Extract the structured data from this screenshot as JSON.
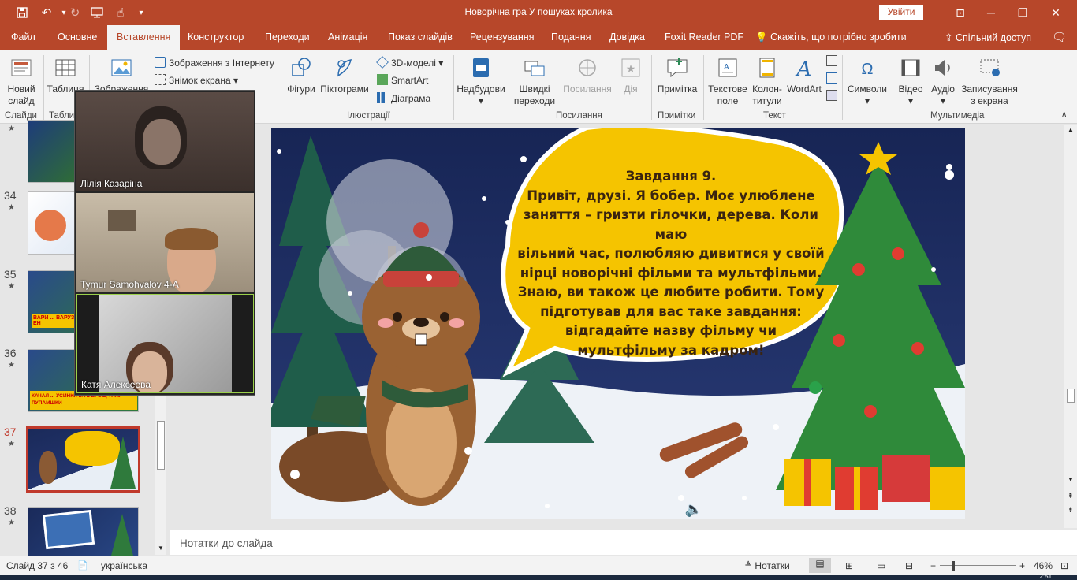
{
  "titlebar": {
    "document_title": "Новорічна гра У пошуках кролика",
    "sign_in": "Увійти",
    "ribbon_display_symbol": "⊡",
    "minimize_symbol": "─",
    "restore_symbol": "❐",
    "close_symbol": "✕"
  },
  "tabs": [
    {
      "label": "Файл"
    },
    {
      "label": "Основне"
    },
    {
      "label": "Вставлення"
    },
    {
      "label": "Конструктор"
    },
    {
      "label": "Переходи"
    },
    {
      "label": "Анімація"
    },
    {
      "label": "Показ слайдів"
    },
    {
      "label": "Рецензування"
    },
    {
      "label": "Подання"
    },
    {
      "label": "Довідка"
    },
    {
      "label": "Foxit Reader PDF"
    }
  ],
  "tell_me": "Скажіть, що потрібно зробити",
  "share": "Спільний доступ",
  "ribbon": {
    "new_slide": "Новий слайд",
    "table": "Таблиця",
    "images": "Зображення",
    "online_images": "Зображення з Інтернету",
    "screenshot": "Знімок екрана",
    "shapes": "Фігури",
    "icons": "Піктограми",
    "models_3d": "3D-моделі",
    "smartart": "SmartArt",
    "chart": "Діаграма",
    "addins": "Надбудови",
    "quick_links": "Швидкі переходи",
    "links": "Посилання",
    "action": "Дія",
    "comment": "Примітка",
    "text_box": "Текстове поле",
    "header_footer": "Колон-титули",
    "wordart": "WordArt",
    "symbols": "Символи",
    "video": "Відео",
    "audio": "Аудіо",
    "screen_recording": "Записування з екрана",
    "groups": {
      "slides": "Слайди",
      "tables": "Табли",
      "illustrations": "Ілюстрації",
      "links": "Посилання",
      "comments": "Примітки",
      "text": "Текст",
      "multimedia": "Мультимедіа"
    }
  },
  "thumbnails": [
    {
      "number": "34",
      "star": "★"
    },
    {
      "number": "35",
      "star": "★",
      "caption": "ВАРИ ... ВАРУЗ ЕН"
    },
    {
      "number": "36",
      "star": "★",
      "caption": "КАЧАЛ ... УСИНКИ ... ЛУБГОЩ ТЯКУ ПУПАМШКИ"
    },
    {
      "number": "37",
      "star": "★"
    },
    {
      "number": "38",
      "star": "★"
    }
  ],
  "video_participants": [
    {
      "name": "Лілія Казаріна"
    },
    {
      "name": "Tymur Samohvalov 4-A"
    },
    {
      "name": "Катя Алексеева"
    }
  ],
  "slide": {
    "task_title": "Завдання 9.",
    "lines": [
      "Привіт, друзі. Я бобер.  Моє улюблене",
      "заняття – гризти гілочки, дерева. Коли маю",
      "вільний час, полюбляю дивитися у своїй",
      "нірці новорічні фільми та мультфільми.",
      "Знаю, ви також це любите робити. Тому",
      "підготував для вас таке завдання:",
      "відгадайте назву фільму чи",
      "мультфільму за кадром!"
    ]
  },
  "notes_placeholder": "Нотатки до слайда",
  "status": {
    "slide_counter": "Слайд 37 з 46",
    "language": "українська",
    "notes": "Нотатки",
    "zoom": "46%",
    "time_partial": "12:51"
  },
  "colors": {
    "accent": "#b7472a",
    "active_thumb_border": "#c0392b",
    "bubble": "#f5c400"
  }
}
